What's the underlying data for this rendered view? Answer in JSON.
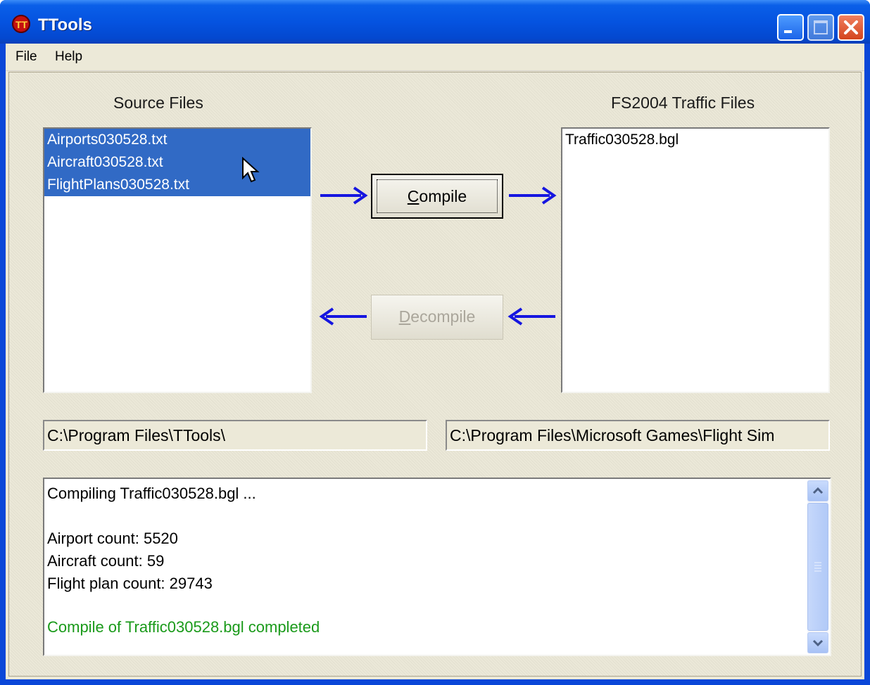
{
  "window": {
    "title": "TTools"
  },
  "menu": {
    "file": "File",
    "help": "Help"
  },
  "source": {
    "label": "Source Files",
    "items": [
      "Airports030528.txt",
      "Aircraft030528.txt",
      "FlightPlans030528.txt"
    ],
    "path": "C:\\Program Files\\TTools\\"
  },
  "traffic": {
    "label": "FS2004 Traffic Files",
    "items": [
      "Traffic030528.bgl"
    ],
    "path": "C:\\Program Files\\Microsoft Games\\Flight Sim"
  },
  "buttons": {
    "compile": {
      "first": "C",
      "rest": "ompile"
    },
    "decompile": {
      "first": "D",
      "rest": "ecompile"
    }
  },
  "log": [
    "Compiling Traffic030528.bgl ...",
    "Airport count: 5520",
    "Aircraft count: 59",
    "Flight plan count: 29743",
    "Compile of Traffic030528.bgl completed"
  ],
  "colors": {
    "selection": "#316ac5",
    "arrow": "#1515e0",
    "success": "#1a9a1a"
  }
}
